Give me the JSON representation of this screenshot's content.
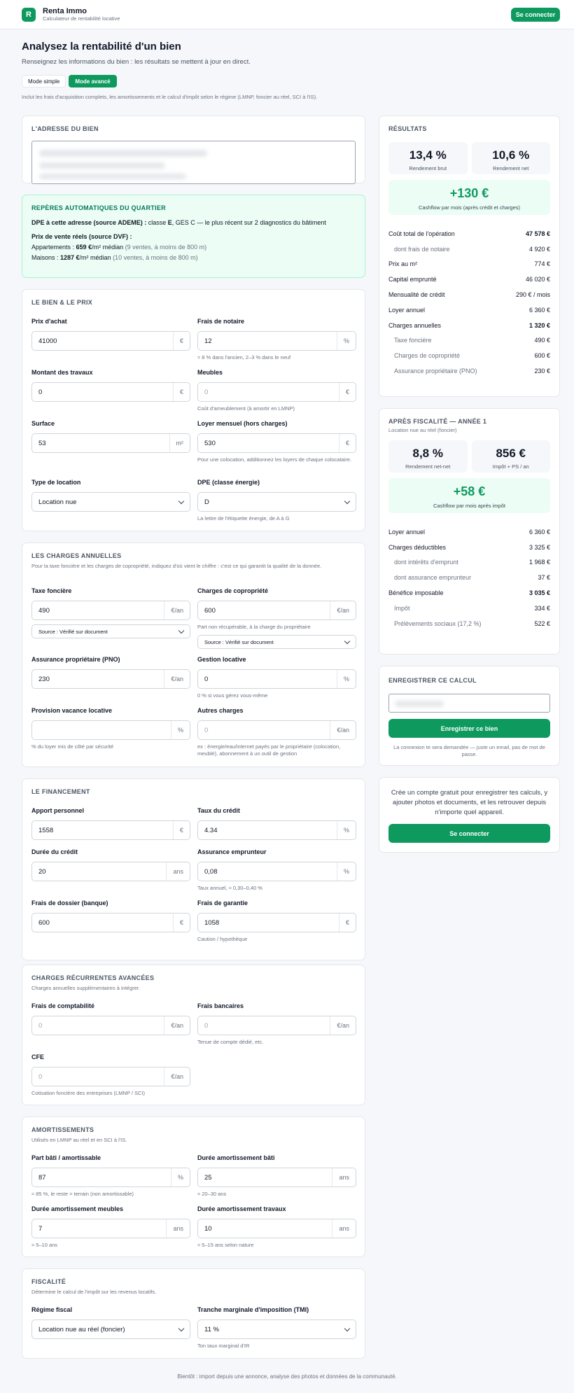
{
  "header": {
    "logo_letter": "R",
    "app_name": "Renta Immo",
    "tagline": "Calculateur de rentabilité locative",
    "login_label": "Se connecter"
  },
  "page": {
    "title": "Analysez la rentabilité d'un bien",
    "intro": "Renseignez les informations du bien : les résultats se mettent à jour en direct.",
    "mode_simple": "Mode simple",
    "mode_advanced": "Mode avancé",
    "mode_note": "Inclut les frais d'acquisition complets, les amortissements et le calcul d'impôt selon le régime (LMNP, foncier au réel, SCI à l'IS)."
  },
  "address": {
    "title": "L'adresse du bien"
  },
  "quartier": {
    "title": "Repères automatiques du quartier",
    "dpe_label": "DPE à cette adresse (source ADEME) :",
    "dpe_text_a": " classe ",
    "dpe_class": "E",
    "dpe_text_b": ", GES C — le plus récent sur 2 diagnostics du bâtiment",
    "dvf_label": "Prix de vente réels (source DVF) :",
    "appart_label": "Appartements : ",
    "appart_price": "659 €",
    "appart_unit": "/m² médian ",
    "appart_detail": "(9 ventes, à moins de 800 m)",
    "maison_label": "Maisons : ",
    "maison_price": "1287 €",
    "maison_unit": "/m² médian ",
    "maison_detail": "(10 ventes, à moins de 800 m)"
  },
  "bien": {
    "title": "Le bien & le prix",
    "prix_label": "Prix d'achat",
    "prix_value": "41000",
    "prix_unit": "€",
    "notaire_label": "Frais de notaire",
    "notaire_value": "12",
    "notaire_unit": "%",
    "notaire_hint": "≈ 8 % dans l'ancien, 2–3 % dans le neuf",
    "travaux_label": "Montant des travaux",
    "travaux_value": "0",
    "travaux_unit": "€",
    "meubles_label": "Meubles",
    "meubles_value": "0",
    "meubles_unit": "€",
    "meubles_hint": "Coût d'ameublement (à amortir en LMNP)",
    "surface_label": "Surface",
    "surface_value": "53",
    "surface_unit": "m²",
    "loyer_label": "Loyer mensuel (hors charges)",
    "loyer_value": "530",
    "loyer_unit": "€",
    "loyer_hint": "Pour une colocation, additionnez les loyers de chaque colocataire.",
    "type_label": "Type de location",
    "type_value": "Location nue",
    "dpe_label": "DPE (classe énergie)",
    "dpe_value": "D",
    "dpe_hint": "La lettre de l'étiquette énergie, de A à G"
  },
  "charges": {
    "title": "Les charges annuelles",
    "sub": "Pour la taxe foncière et les charges de copropriété, indiquez d'où vient le chiffre : c'est ce qui garantit la qualité de la donnée.",
    "tf_label": "Taxe foncière",
    "tf_value": "490",
    "tf_unit": "€/an",
    "tf_source": "Source : Vérifié sur document",
    "copro_label": "Charges de copropriété",
    "copro_value": "600",
    "copro_unit": "€/an",
    "copro_hint": "Part non récupérable, à la charge du propriétaire",
    "copro_source": "Source : Vérifié sur document",
    "pno_label": "Assurance propriétaire (PNO)",
    "pno_value": "230",
    "pno_unit": "€/an",
    "gestion_label": "Gestion locative",
    "gestion_value": "0",
    "gestion_unit": "%",
    "gestion_hint": "0 % si vous gérez vous-même",
    "vacance_label": "Provision vacance locative",
    "vacance_value": "",
    "vacance_unit": "%",
    "vacance_hint": "% du loyer mis de côté par sécurité",
    "autres_label": "Autres charges",
    "autres_value": "0",
    "autres_unit": "€/an",
    "autres_hint": "ex : énergie/eau/internet payés par le propriétaire (colocation, meublé), abonnement à un outil de gestion"
  },
  "financement": {
    "title": "Le financement",
    "apport_label": "Apport personnel",
    "apport_value": "1558",
    "apport_unit": "€",
    "taux_label": "Taux du crédit",
    "taux_value": "4.34",
    "taux_unit": "%",
    "duree_label": "Durée du crédit",
    "duree_value": "20",
    "duree_unit": "ans",
    "assur_label": "Assurance emprunteur",
    "assur_value": "0,08",
    "assur_unit": "%",
    "assur_hint": "Taux annuel, ≈ 0,30–0,40 %",
    "dossier_label": "Frais de dossier (banque)",
    "dossier_value": "600",
    "dossier_unit": "€",
    "garantie_label": "Frais de garantie",
    "garantie_value": "1058",
    "garantie_unit": "€",
    "garantie_hint": "Caution / hypothèque"
  },
  "recurrentes": {
    "title": "Charges récurrentes avancées",
    "sub": "Charges annuelles supplémentaires à intégrer.",
    "compta_label": "Frais de comptabilité",
    "compta_value": "0",
    "compta_unit": "€/an",
    "banc_label": "Frais bancaires",
    "banc_value": "0",
    "banc_unit": "€/an",
    "banc_hint": "Tenue de compte dédié, etc.",
    "cfe_label": "CFE",
    "cfe_value": "0",
    "cfe_unit": "€/an",
    "cfe_hint": "Cotisation foncière des entreprises (LMNP / SCI)"
  },
  "amort": {
    "title": "Amortissements",
    "sub": "Utilisés en LMNP au réel et en SCI à l'IS.",
    "bati_label": "Part bâti / amortissable",
    "bati_value": "87",
    "bati_unit": "%",
    "bati_hint": "≈ 85 %, le reste = terrain (non amortissable)",
    "dbati_label": "Durée amortissement bâti",
    "dbati_value": "25",
    "dbati_unit": "ans",
    "dbati_hint": "≈ 20–30 ans",
    "dmeub_label": "Durée amortissement meubles",
    "dmeub_value": "7",
    "dmeub_unit": "ans",
    "dmeub_hint": "≈ 5–10 ans",
    "dtrav_label": "Durée amortissement travaux",
    "dtrav_value": "10",
    "dtrav_unit": "ans",
    "dtrav_hint": "≈ 5–15 ans selon nature"
  },
  "fiscalite": {
    "title": "Fiscalité",
    "sub": "Détermine le calcul de l'impôt sur les revenus locatifs.",
    "regime_label": "Régime fiscal",
    "regime_value": "Location nue au réel (foncier)",
    "tmi_label": "Tranche marginale d'imposition (TMI)",
    "tmi_value": "11 %",
    "tmi_hint": "Ton taux marginal d'IR"
  },
  "results": {
    "title": "Résultats",
    "kpi1_value": "13,4 %",
    "kpi1_label": "Rendement brut",
    "kpi2_value": "10,6 %",
    "kpi2_label": "Rendement net",
    "cash_value": "+130 €",
    "cash_label": "Cashflow par mois (après crédit et charges)",
    "rows": [
      {
        "label": "Coût total de l'opération",
        "value": "47 578 €",
        "bold": true,
        "indent": false
      },
      {
        "label": "dont frais de notaire",
        "value": "4 920 €",
        "bold": false,
        "indent": true
      },
      {
        "label": "Prix au m²",
        "value": "774 €",
        "bold": false,
        "indent": false
      },
      {
        "label": "Capital emprunté",
        "value": "46 020 €",
        "bold": false,
        "indent": false
      },
      {
        "label": "Mensualité de crédit",
        "value": "290 € / mois",
        "bold": false,
        "indent": false
      },
      {
        "label": "Loyer annuel",
        "value": "6 360 €",
        "bold": false,
        "indent": false
      },
      {
        "label": "Charges annuelles",
        "value": "1 320 €",
        "bold": true,
        "indent": false
      },
      {
        "label": "Taxe foncière",
        "value": "490 €",
        "bold": false,
        "indent": true
      },
      {
        "label": "Charges de copropriété",
        "value": "600 €",
        "bold": false,
        "indent": true
      },
      {
        "label": "Assurance propriétaire (PNO)",
        "value": "230 €",
        "bold": false,
        "indent": true
      }
    ]
  },
  "fiscal": {
    "title": "Après fiscalité — année 1",
    "sub": "Location nue au réel (foncier)",
    "kpi1_value": "8,8 %",
    "kpi1_label": "Rendement net-net",
    "kpi2_value": "856 €",
    "kpi2_label": "Impôt + PS / an",
    "cash_value": "+58 €",
    "cash_label": "Cashflow par mois après impôt",
    "rows": [
      {
        "label": "Loyer annuel",
        "value": "6 360 €",
        "bold": false,
        "indent": false
      },
      {
        "label": "Charges déductibles",
        "value": "3 325 €",
        "bold": false,
        "indent": false
      },
      {
        "label": "dont intérêts d'emprunt",
        "value": "1 968 €",
        "bold": false,
        "indent": true
      },
      {
        "label": "dont assurance emprunteur",
        "value": "37 €",
        "bold": false,
        "indent": true
      },
      {
        "label": "Bénéfice imposable",
        "value": "3 035 €",
        "bold": true,
        "indent": false
      },
      {
        "label": "Impôt",
        "value": "334 €",
        "bold": false,
        "indent": true
      },
      {
        "label": "Prélèvements sociaux (17,2 %)",
        "value": "522 €",
        "bold": false,
        "indent": true
      }
    ]
  },
  "save": {
    "title": "Enregistrer ce calcul",
    "button": "Enregistrer ce bien",
    "note": "La connexion te sera demandée — juste un email, pas de mot de passe."
  },
  "cta": {
    "text": "Crée un compte gratuit pour enregistrer tes calculs, y ajouter photos et documents, et les retrouver depuis n'importe quel appareil.",
    "button": "Se connecter"
  },
  "footer": {
    "text": "Bientôt : import depuis une annonce, analyse des photos et données de la communauté."
  },
  "colors": {
    "accent": "#0e9a5f",
    "mint": "#ecfdf5"
  }
}
